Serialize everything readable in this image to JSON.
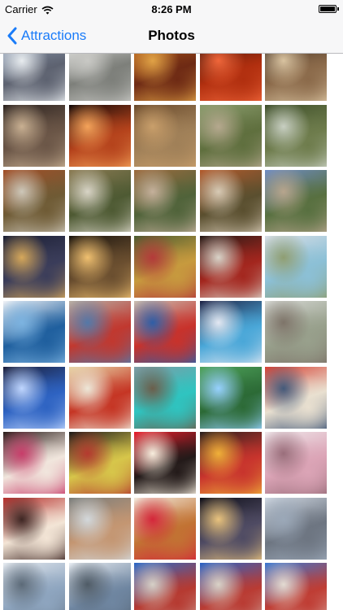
{
  "status_bar": {
    "carrier": "Carrier",
    "time": "8:26 PM",
    "wifi_icon": "wifi-icon",
    "battery_icon": "battery-icon"
  },
  "nav_bar": {
    "back_label": "Attractions",
    "back_icon": "chevron-left-icon",
    "title": "Photos",
    "accent_color": "#1a7cf9"
  },
  "photos": [
    {
      "subject": "building",
      "colors": [
        "#9eb0c8",
        "#5d6270",
        "#e8ecef"
      ]
    },
    {
      "subject": "gallery",
      "colors": [
        "#f1f1ef",
        "#7d7f7a",
        "#c8c8c4"
      ]
    },
    {
      "subject": "textile",
      "colors": [
        "#c66b1c",
        "#6e2a14",
        "#e0a246"
      ]
    },
    {
      "subject": "masks",
      "colors": [
        "#1b0d09",
        "#b12f0f",
        "#f0663a"
      ]
    },
    {
      "subject": "masks",
      "colors": [
        "#2a1d16",
        "#8b6a4a",
        "#d9c3a0"
      ]
    },
    {
      "subject": "masks",
      "colors": [
        "#2c2320",
        "#6b5647",
        "#c9b092"
      ]
    },
    {
      "subject": "pumpkins",
      "colors": [
        "#120807",
        "#b5431c",
        "#f4a35a"
      ]
    },
    {
      "subject": "park",
      "colors": [
        "#6a4a2c",
        "#a08058",
        "#c99f6b"
      ]
    },
    {
      "subject": "hillside",
      "colors": [
        "#8a9c6d",
        "#5f6f3e",
        "#b5a88e"
      ]
    },
    {
      "subject": "stream",
      "colors": [
        "#3e4f2a",
        "#6e7c4c",
        "#c8cfc2"
      ]
    },
    {
      "subject": "autumn",
      "colors": [
        "#a24e27",
        "#6f5b35",
        "#cdc7b9"
      ]
    },
    {
      "subject": "autumn",
      "colors": [
        "#8a7a52",
        "#4e5a33",
        "#d8d4c6"
      ]
    },
    {
      "subject": "bridge",
      "colors": [
        "#9c6a3d",
        "#50633a",
        "#c4b09b"
      ]
    },
    {
      "subject": "autumn",
      "colors": [
        "#b25a2c",
        "#5a4f2f",
        "#d7cab5"
      ]
    },
    {
      "subject": "valley",
      "colors": [
        "#6e8cc3",
        "#587040",
        "#b7a58d"
      ]
    },
    {
      "subject": "night-street",
      "colors": [
        "#1c2035",
        "#3b3d5a",
        "#d6a85b"
      ]
    },
    {
      "subject": "night-arch",
      "colors": [
        "#1a140e",
        "#6a4e2f",
        "#f0c070"
      ]
    },
    {
      "subject": "characters",
      "colors": [
        "#4a5c30",
        "#c79a3e",
        "#b43a3a"
      ]
    },
    {
      "subject": "stage",
      "colors": [
        "#261a16",
        "#a3261e",
        "#d9d3c8"
      ]
    },
    {
      "subject": "castle",
      "colors": [
        "#d8dee6",
        "#8cc0d6",
        "#8f9e72"
      ]
    },
    {
      "subject": "globe",
      "colors": [
        "#f1f3f6",
        "#1f5f9e",
        "#7cb3e0"
      ]
    },
    {
      "subject": "plaza",
      "colors": [
        "#b7b0a6",
        "#c1382f",
        "#5478a8"
      ]
    },
    {
      "subject": "parade",
      "colors": [
        "#c9bfb2",
        "#c8322b",
        "#2f5ea6"
      ]
    },
    {
      "subject": "globe-night",
      "colors": [
        "#1e2346",
        "#4aa7d8",
        "#e3e8f2"
      ]
    },
    {
      "subject": "street",
      "colors": [
        "#d6d8d4",
        "#98a08c",
        "#7e7469"
      ]
    },
    {
      "subject": "sign-night",
      "colors": [
        "#1b1e3a",
        "#2e63c2",
        "#bfd6ff"
      ]
    },
    {
      "subject": "storefront",
      "colors": [
        "#e8d7a8",
        "#c53524",
        "#ede7d8"
      ]
    },
    {
      "subject": "pool",
      "colors": [
        "#7f9ca6",
        "#2fc4c0",
        "#6b5e4b"
      ]
    },
    {
      "subject": "green-facade",
      "colors": [
        "#4ea25a",
        "#2c6a36",
        "#97d1ff"
      ]
    },
    {
      "subject": "diner",
      "colors": [
        "#d64033",
        "#e9e0d0",
        "#445a7a"
      ]
    },
    {
      "subject": "poster",
      "colors": [
        "#2a1d1a",
        "#f1e6dd",
        "#c83d6a"
      ]
    },
    {
      "subject": "stickers",
      "colors": [
        "#1d1b1a",
        "#d7c64a",
        "#b53a2f"
      ]
    },
    {
      "subject": "cafe-sign",
      "colors": [
        "#e81d2b",
        "#231a19",
        "#f7eede"
      ]
    },
    {
      "subject": "shop-sign",
      "colors": [
        "#2a201e",
        "#c8342d",
        "#f0b039"
      ]
    },
    {
      "subject": "dresses",
      "colors": [
        "#efe7ea",
        "#dba4b6",
        "#9a6e7b"
      ]
    },
    {
      "subject": "mural",
      "colors": [
        "#b52d2a",
        "#f3e5d6",
        "#3e2623"
      ]
    },
    {
      "subject": "shopping-street",
      "colors": [
        "#7a7d7b",
        "#c49672",
        "#d3d8db"
      ]
    },
    {
      "subject": "burger",
      "colors": [
        "#f2eadd",
        "#c27333",
        "#d4263a"
      ]
    },
    {
      "subject": "night-road",
      "colors": [
        "#0e0e18",
        "#4f4b63",
        "#e9c37e"
      ]
    },
    {
      "subject": "city-view",
      "colors": [
        "#cfd7e1",
        "#6d7581",
        "#9ba8b8"
      ]
    },
    {
      "subject": "dome-skyline",
      "colors": [
        "#e4e9ef",
        "#8ea5bf",
        "#5c6a78"
      ]
    },
    {
      "subject": "dome-city",
      "colors": [
        "#e6ebf1",
        "#6f86a1",
        "#4f5b66"
      ]
    },
    {
      "subject": "ship-building",
      "colors": [
        "#2b68c7",
        "#b63a31",
        "#d6d0c7"
      ]
    },
    {
      "subject": "ship-building",
      "colors": [
        "#2a63c6",
        "#b93b33",
        "#d9d2c7"
      ]
    },
    {
      "subject": "ship-building",
      "colors": [
        "#3a78d2",
        "#bf3d34",
        "#e3dbd2"
      ]
    }
  ]
}
